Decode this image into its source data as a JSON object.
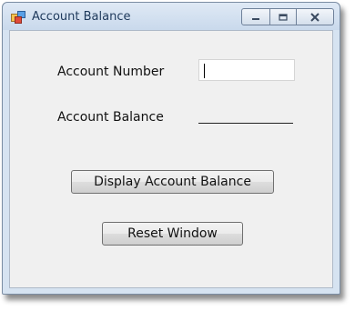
{
  "window": {
    "title": "Account Balance"
  },
  "form": {
    "account_number_label": "Account Number",
    "account_number_value": "",
    "account_balance_label": "Account Balance",
    "account_balance_value": ""
  },
  "buttons": {
    "display_balance_label": "Display Account Balance",
    "reset_label": "Reset Window"
  },
  "icons": {
    "app": "window-app-icon",
    "minimize": "minimize-icon",
    "maximize": "maximize-icon",
    "close": "close-icon"
  },
  "colors": {
    "titlebar": "#c9d9ec",
    "client_background": "#f0f0f0",
    "title_text": "#1e395b"
  }
}
